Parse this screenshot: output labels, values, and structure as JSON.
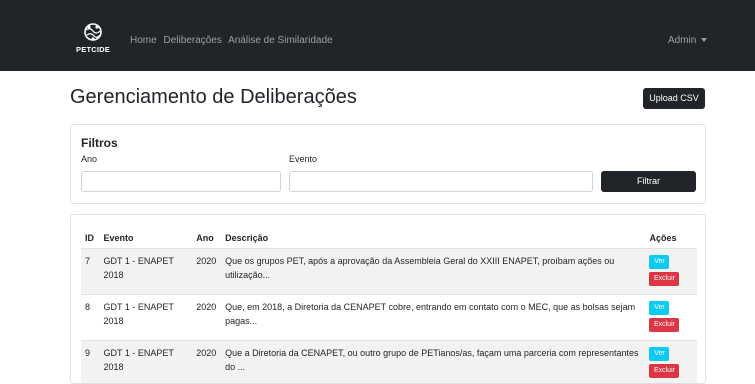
{
  "navbar": {
    "brand": "PETCIDE",
    "links": [
      "Home",
      "Deliberações",
      "Análise de Similaridade"
    ],
    "user_menu": "Admin"
  },
  "page": {
    "title": "Gerenciamento de Deliberações",
    "upload_label": "Upload CSV"
  },
  "filters": {
    "title": "Filtros",
    "ano_label": "Ano",
    "ano_value": "",
    "evento_label": "Evento",
    "evento_value": "",
    "filter_label": "Filtrar"
  },
  "table": {
    "headers": [
      "ID",
      "Evento",
      "Ano",
      "Descrição",
      "Ações"
    ],
    "rows": [
      {
        "id": "7",
        "evento": "GDT 1 - ENAPET 2018",
        "ano": "2020",
        "descricao": "Que os grupos PET, após a aprovação da Assembleia Geral do XXIII ENAPET, proíbam ações ou utilização..."
      },
      {
        "id": "8",
        "evento": "GDT 1 - ENAPET 2018",
        "ano": "2020",
        "descricao": "Que, em 2018, a Diretoria da CENAPET cobre, entrando em contato com o MEC, que as bolsas sejam pagas..."
      },
      {
        "id": "9",
        "evento": "GDT 1 - ENAPET 2018",
        "ano": "2020",
        "descricao": "Que a Diretoria da CENAPET, ou outro grupo de PETianos/as, façam uma parceria com representantes do ..."
      }
    ],
    "ver_label": "Ver",
    "excluir_label": "Excluir"
  },
  "colors": {
    "navbar": "#212529",
    "info": "#0dcaf0",
    "danger": "#dc3545"
  }
}
